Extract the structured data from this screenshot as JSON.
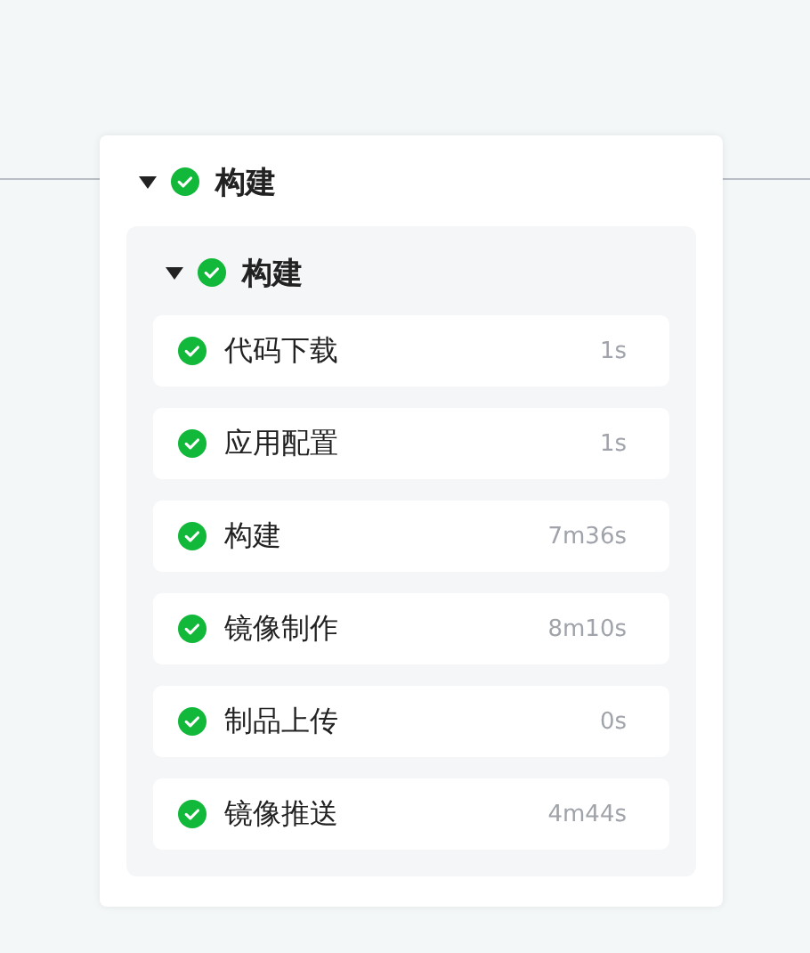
{
  "stage": {
    "title": "构建",
    "succeeded": true,
    "expanded": true,
    "job": {
      "title": "构建",
      "succeeded": true,
      "expanded": true,
      "steps": [
        {
          "name": "代码下载",
          "succeeded": true,
          "duration": "1s"
        },
        {
          "name": "应用配置",
          "succeeded": true,
          "duration": "1s"
        },
        {
          "name": "构建",
          "succeeded": true,
          "duration": "7m36s"
        },
        {
          "name": "镜像制作",
          "succeeded": true,
          "duration": "8m10s"
        },
        {
          "name": "制品上传",
          "succeeded": true,
          "duration": "0s"
        },
        {
          "name": "镜像推送",
          "succeeded": true,
          "duration": "4m44s"
        }
      ]
    }
  }
}
